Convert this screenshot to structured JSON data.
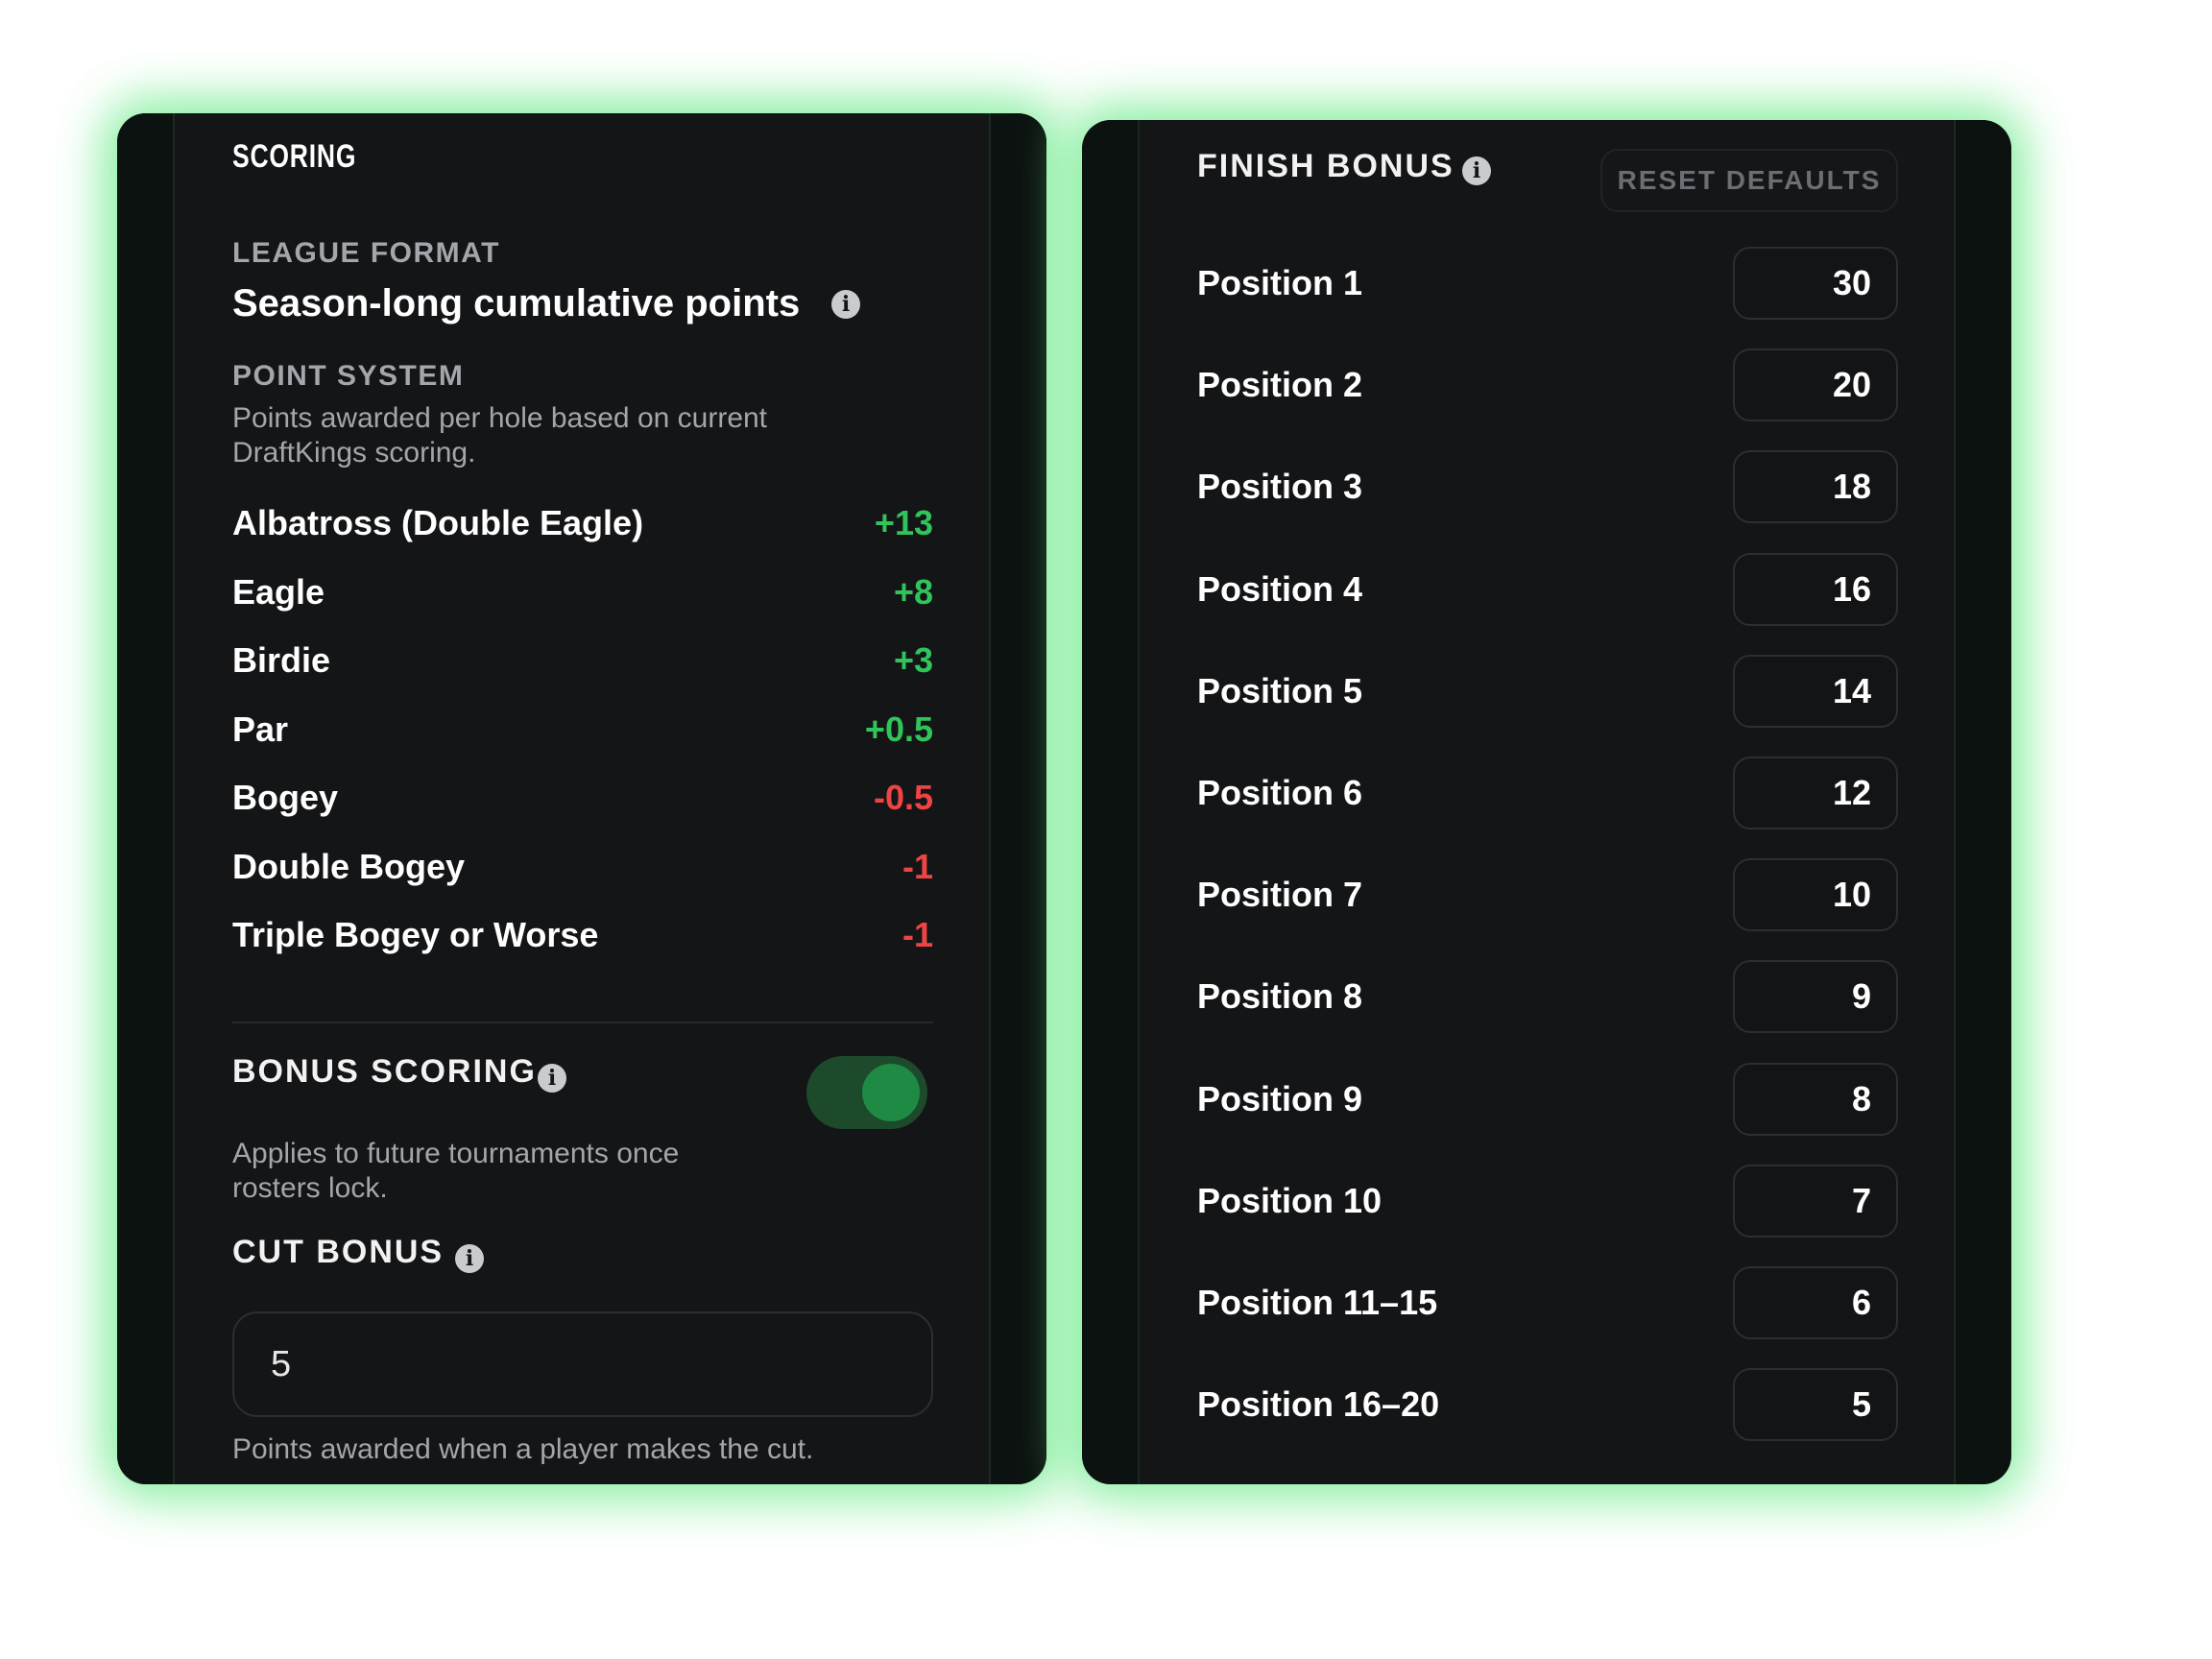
{
  "scoring": {
    "title": "SCORING",
    "league_format_label": "LEAGUE FORMAT",
    "league_format_value": "Season-long cumulative points",
    "point_system_label": "POINT SYSTEM",
    "point_system_desc": "Points awarded per hole based on current DraftKings scoring.",
    "rows": [
      {
        "label": "Albatross (Double Eagle)",
        "value": "+13",
        "sign": "positive"
      },
      {
        "label": "Eagle",
        "value": "+8",
        "sign": "positive"
      },
      {
        "label": "Birdie",
        "value": "+3",
        "sign": "positive"
      },
      {
        "label": "Par",
        "value": "+0.5",
        "sign": "positive"
      },
      {
        "label": "Bogey",
        "value": "-0.5",
        "sign": "negative"
      },
      {
        "label": "Double Bogey",
        "value": "-1",
        "sign": "negative"
      },
      {
        "label": "Triple Bogey or Worse",
        "value": "-1",
        "sign": "negative"
      }
    ],
    "bonus_scoring_label": "BONUS SCORING",
    "bonus_scoring_enabled": true,
    "bonus_scoring_desc": "Applies to future tournaments once rosters lock.",
    "cut_bonus_label": "CUT BONUS",
    "cut_bonus_value": "5",
    "cut_bonus_help": "Points awarded when a player makes the cut."
  },
  "finish_bonus": {
    "title": "FINISH BONUS",
    "reset_label": "RESET DEFAULTS",
    "rows": [
      {
        "label": "Position 1",
        "value": "30"
      },
      {
        "label": "Position 2",
        "value": "20"
      },
      {
        "label": "Position 3",
        "value": "18"
      },
      {
        "label": "Position 4",
        "value": "16"
      },
      {
        "label": "Position 5",
        "value": "14"
      },
      {
        "label": "Position 6",
        "value": "12"
      },
      {
        "label": "Position 7",
        "value": "10"
      },
      {
        "label": "Position 8",
        "value": "9"
      },
      {
        "label": "Position 9",
        "value": "8"
      },
      {
        "label": "Position 10",
        "value": "7"
      },
      {
        "label": "Position 11–15",
        "value": "6"
      },
      {
        "label": "Position 16–20",
        "value": "5"
      }
    ]
  },
  "colors": {
    "positive": "#31c45a",
    "negative": "#ef4444",
    "glow": "#7cf096",
    "panel": "#141517"
  },
  "icons": [
    "info-icon"
  ]
}
